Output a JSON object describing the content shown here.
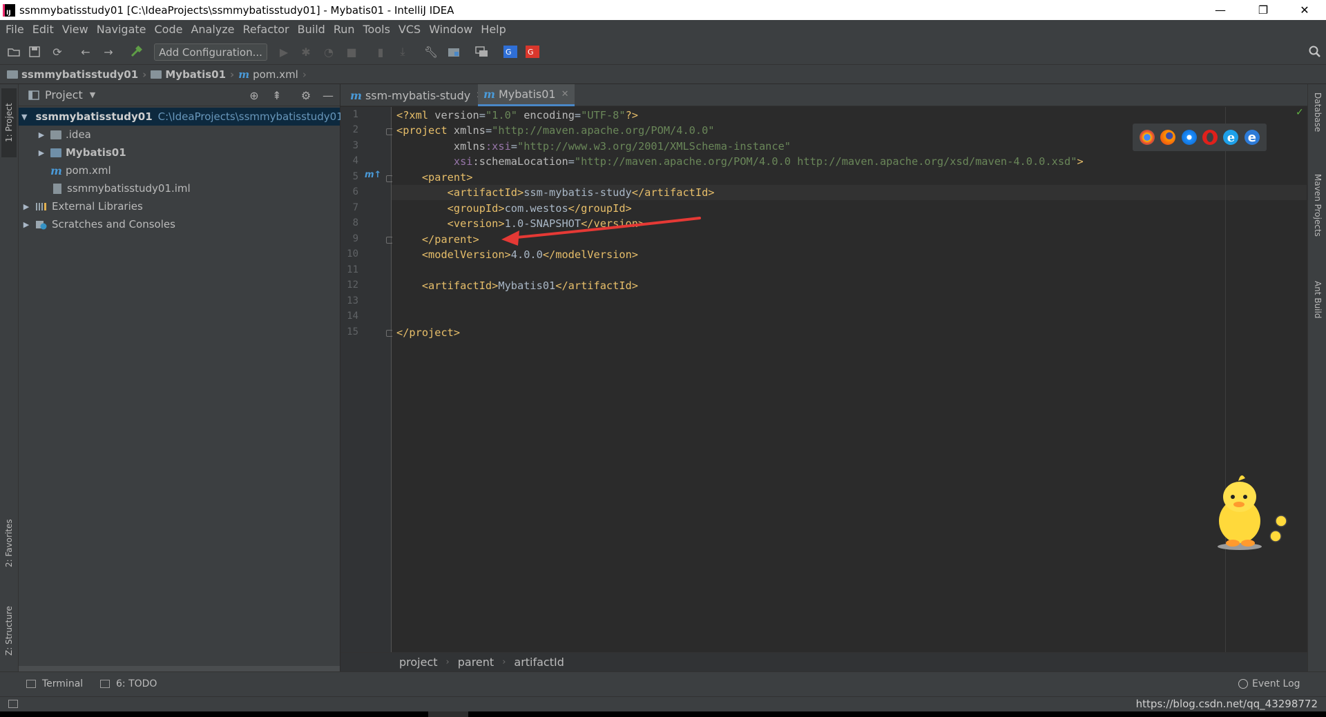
{
  "window": {
    "title": "ssmmybatisstudy01 [C:\\IdeaProjects\\ssmmybatisstudy01] - Mybatis01 - IntelliJ IDEA",
    "minimize_glyph": "—",
    "restore_glyph": "❐",
    "close_glyph": "✕"
  },
  "menu": [
    "File",
    "Edit",
    "View",
    "Navigate",
    "Code",
    "Analyze",
    "Refactor",
    "Build",
    "Run",
    "Tools",
    "VCS",
    "Window",
    "Help"
  ],
  "toolbar": {
    "add_configuration_label": "Add Configuration...",
    "icons": [
      "open-folder-icon",
      "save-icon",
      "sync-icon",
      "back-icon",
      "forward-icon",
      "build-hammer-icon",
      "run-icon",
      "debug-icon",
      "coverage-icon",
      "stop-icon",
      "attach-icon",
      "download-icon",
      "settings-wrench-icon",
      "project-structure-icon",
      "sdk-icon",
      "translate-icon",
      "google-translate-icon",
      "search-everywhere-icon"
    ]
  },
  "breadcrumb": [
    {
      "label": "ssmmybatisstudy01",
      "kind": "folder"
    },
    {
      "label": "Mybatis01",
      "kind": "folder"
    },
    {
      "label": "pom.xml",
      "kind": "maven"
    }
  ],
  "left_strip": {
    "project_tab": "1: Project",
    "favorites_tab": "2: Favorites",
    "structure_tab": "Z: Structure"
  },
  "project_panel": {
    "title": "Project",
    "tree": [
      {
        "label": "ssmmybatisstudy01",
        "path": "C:\\IdeaProjects\\ssmmybatisstudy01",
        "level": 0,
        "expanded": true,
        "kind": "module"
      },
      {
        "label": ".idea",
        "level": 1,
        "expanded": false,
        "kind": "folder"
      },
      {
        "label": "Mybatis01",
        "level": 1,
        "expanded": false,
        "kind": "module"
      },
      {
        "label": "pom.xml",
        "level": 1,
        "kind": "maven"
      },
      {
        "label": "ssmmybatisstudy01.iml",
        "level": 1,
        "kind": "iml"
      },
      {
        "label": "External Libraries",
        "level": 0,
        "expanded": false,
        "kind": "library"
      },
      {
        "label": "Scratches and Consoles",
        "level": 0,
        "expanded": false,
        "kind": "scratch"
      }
    ]
  },
  "editor": {
    "tabs": [
      {
        "label": "ssm-mybatis-study",
        "active": false
      },
      {
        "label": "Mybatis01",
        "active": true
      }
    ],
    "line_numbers": [
      "1",
      "2",
      "3",
      "4",
      "5",
      "6",
      "7",
      "8",
      "9",
      "10",
      "11",
      "12",
      "13",
      "14",
      "15"
    ],
    "lines": {
      "l1": {
        "a": "<?xml ",
        "b": "version",
        "c": "=",
        "d": "\"1.0\"",
        "e": " encoding",
        "f": "=",
        "g": "\"UTF-8\"",
        "h": "?>"
      },
      "l2": {
        "a": "<project ",
        "b": "xmlns",
        "c": "=",
        "d": "\"http://maven.apache.org/POM/4.0.0\""
      },
      "l3": {
        "a": "         xmlns",
        "b": ":xsi",
        "c": "=",
        "d": "\"http://www.w3.org/2001/XMLSchema-instance\""
      },
      "l4": {
        "a": "         xsi",
        "b": ":schemaLocation",
        "c": "=",
        "d": "\"http://maven.apache.org/POM/4.0.0 http://maven.apache.org/xsd/maven-4.0.0.xsd\"",
        "e": ">"
      },
      "l5": {
        "a": "    <parent>"
      },
      "l6": {
        "a": "        <artifactId>",
        "b": "ssm-mybatis-study",
        "c": "</artifactId>"
      },
      "l7": {
        "a": "        <groupId>",
        "b": "com.westos",
        "c": "</groupId>"
      },
      "l8": {
        "a": "        <version>",
        "b": "1.0-SNAPSHOT",
        "c": "</version>"
      },
      "l9": {
        "a": "    </parent>"
      },
      "l10": {
        "a": "    <modelVersion>",
        "b": "4.0.0",
        "c": "</modelVersion>"
      },
      "l12": {
        "a": "    <artifactId>",
        "b": "Mybatis01",
        "c": "</artifactId>"
      },
      "l15": {
        "a": "</project>"
      }
    },
    "crumbs": [
      "project",
      "parent",
      "artifactId"
    ]
  },
  "right_strip": {
    "database_tab": "Database",
    "maven_tab": "Maven Projects",
    "ant_tab": "Ant Build"
  },
  "bottom_tools": {
    "terminal": "Terminal",
    "todo": "6: TODO",
    "event_log": "Event Log"
  },
  "status": {
    "watermark": "https://blog.csdn.net/qq_43298772"
  },
  "colors": {
    "tag": "#e8bf6a",
    "value": "#6a8759",
    "namespace": "#9876aa",
    "annotation_arrow": "#e53935",
    "accent": "#4a88c7"
  }
}
